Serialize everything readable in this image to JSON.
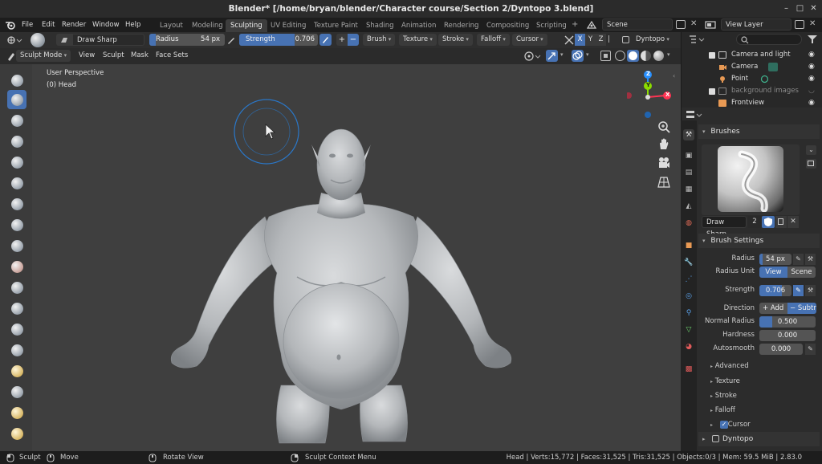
{
  "window": {
    "title": "Blender* [/home/bryan/blender/Character course/Section 2/Dyntopo 3.blend]",
    "controls": [
      "–",
      "□",
      "✕"
    ]
  },
  "topbar": {
    "menus": [
      "File",
      "Edit",
      "Render",
      "Window",
      "Help"
    ],
    "workspaces": [
      "Layout",
      "Modeling",
      "Sculpting",
      "UV Editing",
      "Texture Paint",
      "Shading",
      "Animation",
      "Rendering",
      "Compositing",
      "Scripting"
    ],
    "active_workspace": "Sculpting",
    "scene": "Scene",
    "view_layer": "View Layer"
  },
  "tool_header": {
    "brush_name": "Draw Sharp",
    "radius_label": "Radius",
    "radius_value": "54 px",
    "strength_label": "Strength",
    "strength_value": "0.706",
    "menus": [
      "Brush",
      "Texture",
      "Stroke",
      "Falloff",
      "Cursor"
    ],
    "axes": [
      "X",
      "Y",
      "Z"
    ],
    "dyntopo": "Dyntopo"
  },
  "mode_header": {
    "mode": "Sculpt Mode",
    "menus": [
      "View",
      "Sculpt",
      "Mask",
      "Face Sets"
    ]
  },
  "viewport": {
    "perspective": "User Perspective",
    "object": "(0) Head",
    "gizmo_labels": [
      "Z",
      "Y",
      "X"
    ]
  },
  "outliner": {
    "search_placeholder": "",
    "items": [
      {
        "label": "Camera and light",
        "indent": 0
      },
      {
        "label": "Camera",
        "indent": 1
      },
      {
        "label": "Point",
        "indent": 1
      },
      {
        "label": "background images",
        "indent": 0
      },
      {
        "label": "Frontview",
        "indent": 1
      }
    ]
  },
  "properties": {
    "brushes_header": "Brushes",
    "brush_name": "Draw Sharp",
    "brush_users": "2",
    "brush_settings_header": "Brush Settings",
    "radius_label": "Radius",
    "radius_value": "54 px",
    "radius_unit_label": "Radius Unit",
    "radius_unit_view": "View",
    "radius_unit_scene": "Scene",
    "strength_label": "Strength",
    "strength_value": "0.706",
    "direction_label": "Direction",
    "direction_add": "Add",
    "direction_subtract": "Subtr",
    "normal_radius_label": "Normal Radius",
    "normal_radius_value": "0.500",
    "hardness_label": "Hardness",
    "hardness_value": "0.000",
    "autosmooth_label": "Autosmooth",
    "autosmooth_value": "0.000",
    "subpanels": [
      "Advanced",
      "Texture",
      "Stroke",
      "Falloff",
      "Cursor"
    ],
    "dyntopo_header": "Dyntopo"
  },
  "statusbar": {
    "left_action": "Sculpt",
    "middle_action": "Move",
    "rotate_action": "Rotate View",
    "context_action": "Sculpt Context Menu",
    "stats": "Head | Verts:15,772 | Faces:31,525 | Tris:31,525 | Objects:0/3 | Mem: 59.5 MiB | 2.83.0"
  },
  "colors": {
    "accent": "#4772b3",
    "x_axis": "#ff3352",
    "y_axis": "#8bdc00",
    "z_axis": "#2890ff",
    "brush_ring": "#2a77c8"
  }
}
